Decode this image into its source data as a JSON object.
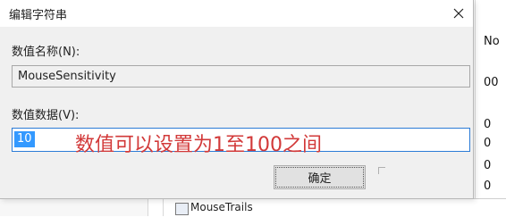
{
  "background": {
    "right_column_values": [
      "No",
      "00",
      "0",
      "0",
      "0",
      "0"
    ],
    "bottom_row_name": "MouseTrails"
  },
  "dialog": {
    "title": "编辑字符串",
    "name_label": "数值名称(N):",
    "name_value": "MouseSensitivity",
    "data_label": "数值数据(V):",
    "data_value": "10",
    "annotation": "数值可以设置为1至100之间",
    "ok_label": "确定",
    "close_icon": "close-icon",
    "annotation_color": "#d23939",
    "selection_color": "#3399ff"
  }
}
